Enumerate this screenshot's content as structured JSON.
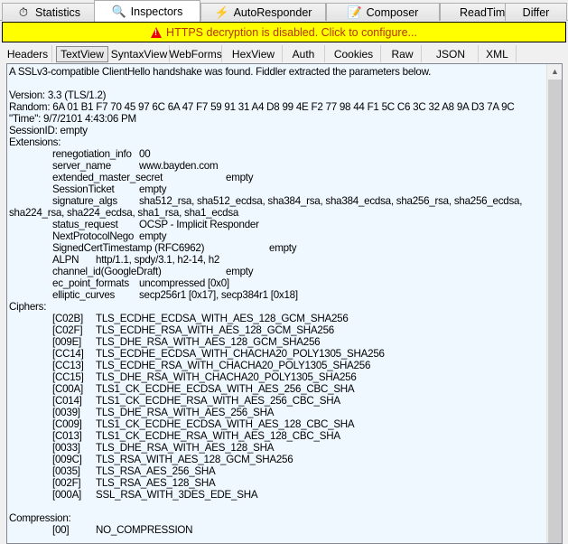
{
  "top_tabs": [
    {
      "label": "Statistics",
      "icon": "stopwatch-icon",
      "glyph": "⏱",
      "active": false
    },
    {
      "label": "Inspectors",
      "icon": "magnifier-icon",
      "glyph": "🔍",
      "active": true
    },
    {
      "label": "AutoResponder",
      "icon": "lightning-icon",
      "glyph": "⚡",
      "active": false
    },
    {
      "label": "Composer",
      "icon": "pencil-note-icon",
      "glyph": "📝",
      "active": false
    },
    {
      "label": "ReadTiming",
      "icon": "",
      "glyph": "",
      "active": false
    },
    {
      "label": "Differ",
      "icon": "",
      "glyph": "",
      "active": false
    }
  ],
  "banner": {
    "text": "HTTPS decryption is disabled. Click to configure...",
    "icon": "warning-icon",
    "bg": "#ffff00",
    "color": "#b53600"
  },
  "sub_tabs": [
    {
      "label": "Headers",
      "active": false
    },
    {
      "label": "TextView",
      "active": true
    },
    {
      "label": "SyntaxView",
      "active": false
    },
    {
      "label": "WebForms",
      "active": false
    },
    {
      "label": "HexView",
      "active": false
    },
    {
      "label": "Auth",
      "active": false
    },
    {
      "label": "Cookies",
      "active": false
    },
    {
      "label": "Raw",
      "active": false
    },
    {
      "label": "JSON",
      "active": false
    },
    {
      "label": "XML",
      "active": false
    }
  ],
  "content": {
    "intro": "A SSLv3-compatible ClientHello handshake was found. Fiddler extracted the parameters below.",
    "version": "Version: 3.3 (TLS/1.2)",
    "random": "Random: 6A 01 B1 F7 70 45 97 6C 6A 47 F7 59 91 31 A4 D8 99 4E F2 77 98 44 F1 5C C6 3C 32 A8 9A D3 7A 9C",
    "time": "\"Time\": 9/7/2101 4:43:06 PM",
    "session": "SessionID: empty",
    "extensions_label": "Extensions:",
    "extensions": [
      {
        "name": "renegotiation_info",
        "value": "00"
      },
      {
        "name": "server_name",
        "value": "www.bayden.com"
      },
      {
        "name": "extended_master_secret",
        "value": "empty"
      },
      {
        "name": "SessionTicket",
        "value": "empty"
      },
      {
        "name": "signature_algs",
        "value": "sha512_rsa, sha512_ecdsa, sha384_rsa, sha384_ecdsa, sha256_rsa, sha256_ecdsa, sha224_rsa, sha224_ecdsa, sha1_rsa, sha1_ecdsa"
      },
      {
        "name": "status_request",
        "value": "OCSP - Implicit Responder"
      },
      {
        "name": "NextProtocolNego",
        "value": "empty"
      },
      {
        "name": "SignedCertTimestamp (RFC6962)",
        "value": "empty"
      },
      {
        "name": "ALPN",
        "value": "http/1.1, spdy/3.1, h2-14, h2"
      },
      {
        "name": "channel_id(GoogleDraft)",
        "value": "empty"
      },
      {
        "name": "ec_point_formats",
        "value": "uncompressed [0x0]"
      },
      {
        "name": "elliptic_curves",
        "value": "secp256r1 [0x17], secp384r1 [0x18]"
      }
    ],
    "ciphers_label": "Ciphers:",
    "ciphers": [
      {
        "code": "[C02B]",
        "name": "TLS_ECDHE_ECDSA_WITH_AES_128_GCM_SHA256"
      },
      {
        "code": "[C02F]",
        "name": "TLS_ECDHE_RSA_WITH_AES_128_GCM_SHA256"
      },
      {
        "code": "[009E]",
        "name": "TLS_DHE_RSA_WITH_AES_128_GCM_SHA256"
      },
      {
        "code": "[CC14]",
        "name": "TLS_ECDHE_ECDSA_WITH_CHACHA20_POLY1305_SHA256"
      },
      {
        "code": "[CC13]",
        "name": "TLS_ECDHE_RSA_WITH_CHACHA20_POLY1305_SHA256"
      },
      {
        "code": "[CC15]",
        "name": "TLS_DHE_RSA_WITH_CHACHA20_POLY1305_SHA256"
      },
      {
        "code": "[C00A]",
        "name": "TLS1_CK_ECDHE_ECDSA_WITH_AES_256_CBC_SHA"
      },
      {
        "code": "[C014]",
        "name": "TLS1_CK_ECDHE_RSA_WITH_AES_256_CBC_SHA"
      },
      {
        "code": "[0039]",
        "name": "TLS_DHE_RSA_WITH_AES_256_SHA"
      },
      {
        "code": "[C009]",
        "name": "TLS1_CK_ECDHE_ECDSA_WITH_AES_128_CBC_SHA"
      },
      {
        "code": "[C013]",
        "name": "TLS1_CK_ECDHE_RSA_WITH_AES_128_CBC_SHA"
      },
      {
        "code": "[0033]",
        "name": "TLS_DHE_RSA_WITH_AES_128_SHA"
      },
      {
        "code": "[009C]",
        "name": "TLS_RSA_WITH_AES_128_GCM_SHA256"
      },
      {
        "code": "[0035]",
        "name": "TLS_RSA_AES_256_SHA"
      },
      {
        "code": "[002F]",
        "name": "TLS_RSA_AES_128_SHA"
      },
      {
        "code": "[000A]",
        "name": "SSL_RSA_WITH_3DES_EDE_SHA"
      }
    ],
    "compression_label": "Compression:",
    "compression": [
      {
        "code": "[00]",
        "name": "NO_COMPRESSION"
      }
    ]
  }
}
